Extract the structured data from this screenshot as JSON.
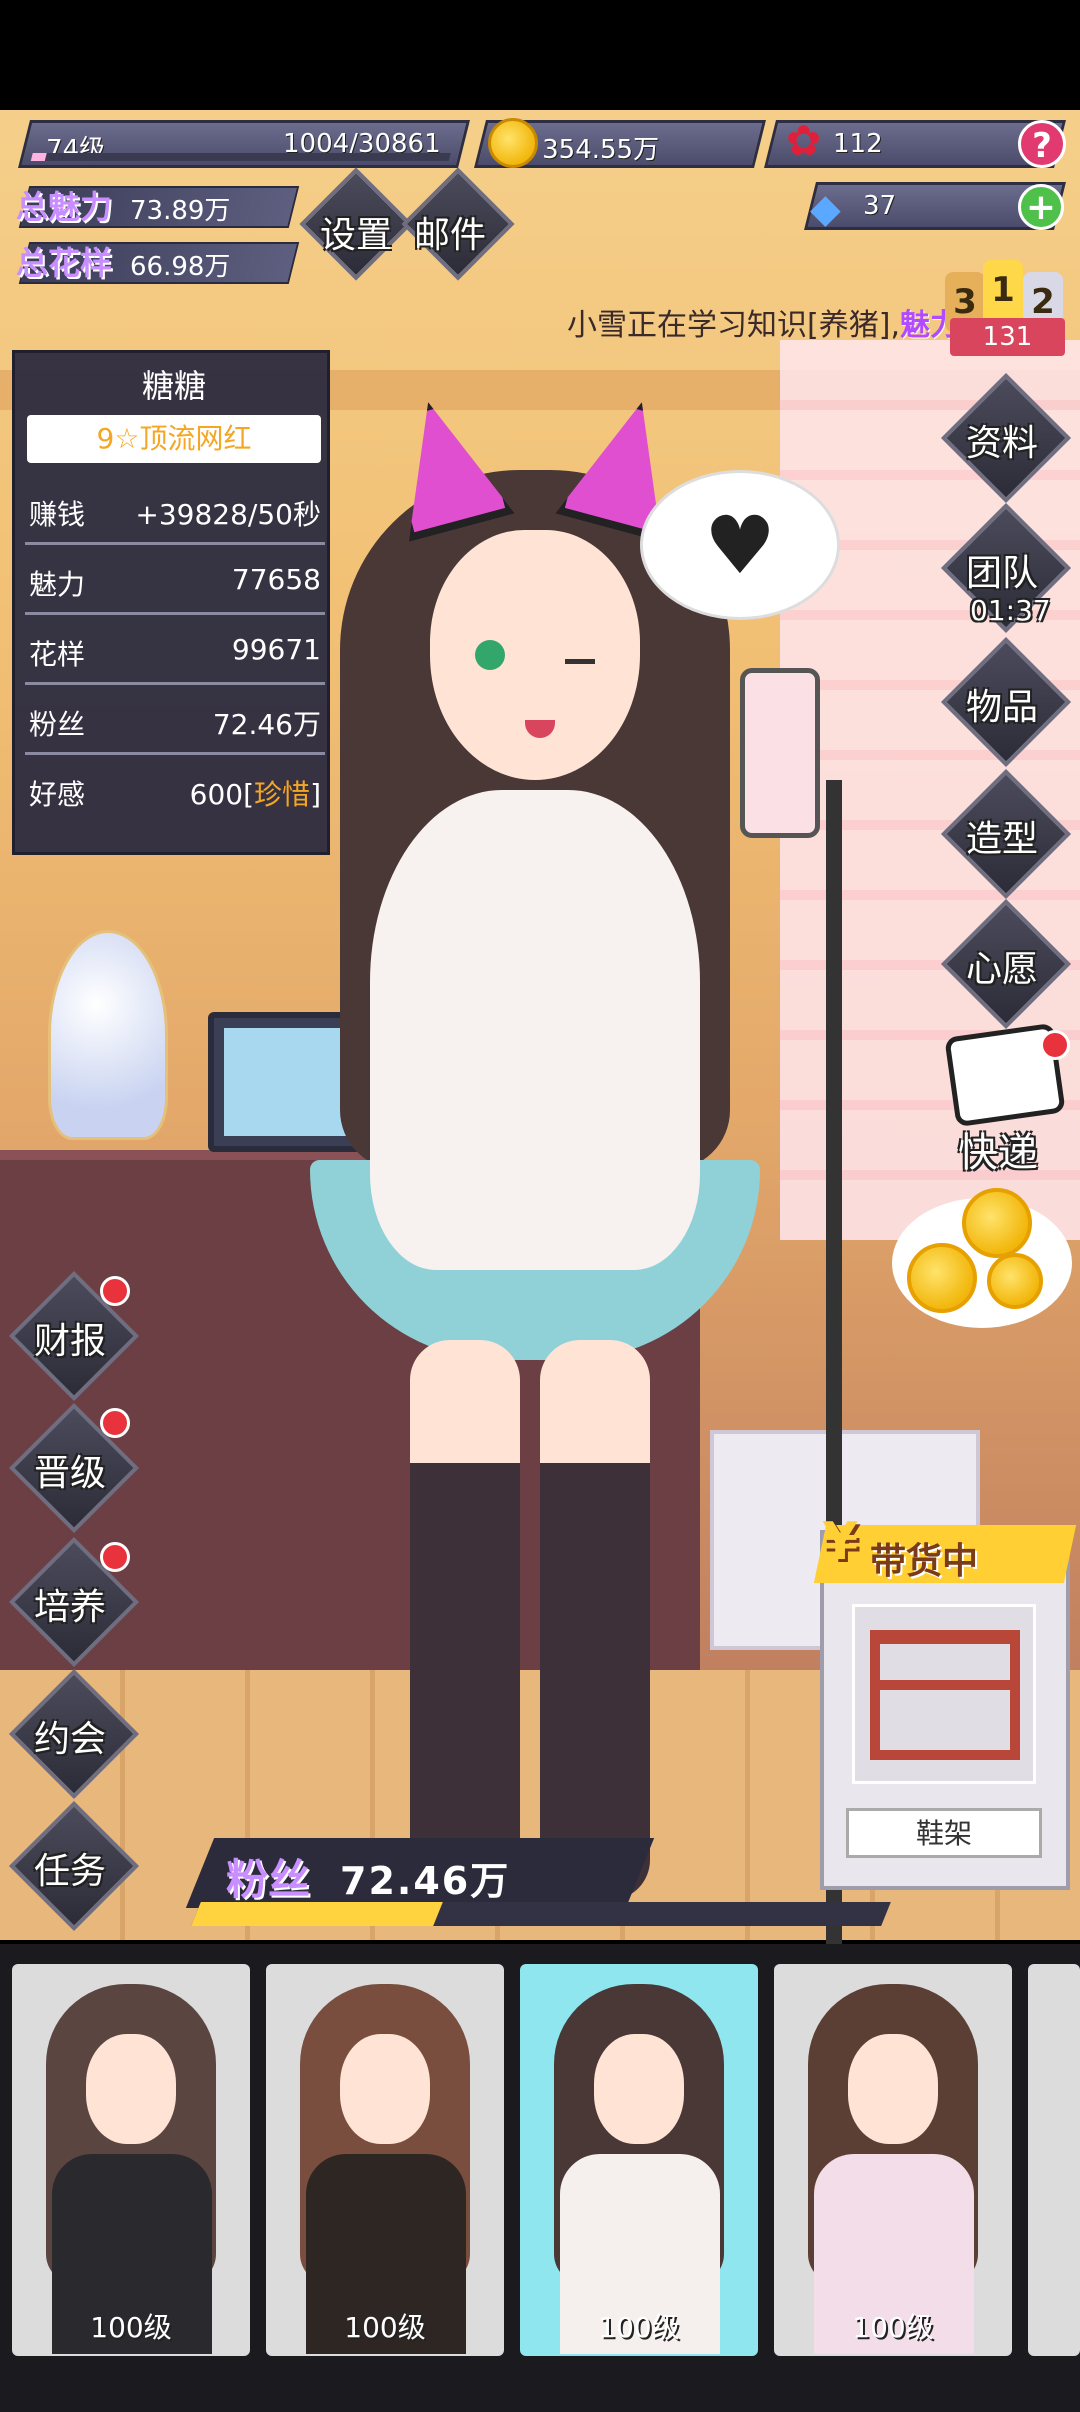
{
  "hud": {
    "level": "74级",
    "exp": "1004/30861",
    "exp_progress": 0.0325,
    "coins": "354.55万",
    "roses": "112",
    "gems": "37",
    "help_icon": "question-icon",
    "plus_icon": "plus-icon"
  },
  "stats": {
    "charm_label": "总魅力",
    "charm_value": "73.89万",
    "style_label": "总花样",
    "style_value": "66.98万"
  },
  "menu_top": {
    "settings": "设置",
    "mail": "邮件"
  },
  "ticker": {
    "text": "小雪正在学习知识[养猪],",
    "highlight": "魅力"
  },
  "rank": {
    "places": [
      "3",
      "1",
      "2"
    ],
    "score": "131"
  },
  "info_panel": {
    "name": "糖糖",
    "title": "9☆顶流网红",
    "rows": [
      {
        "key": "赚钱",
        "value": "+39828/50秒"
      },
      {
        "key": "魅力",
        "value": "77658"
      },
      {
        "key": "花样",
        "value": "99671"
      },
      {
        "key": "粉丝",
        "value": "72.46万"
      },
      {
        "key": "好感",
        "value": "600[",
        "value_hl": "珍惜",
        "value_end": "]"
      }
    ]
  },
  "right_menu": {
    "profile": "资料",
    "team": "团队",
    "team_timer": "01:37",
    "items": "物品",
    "style": "造型",
    "wish": "心愿",
    "express": "快递"
  },
  "left_menu": {
    "earnings": "财报",
    "promote": "晋级",
    "train": "培养",
    "date": "约会",
    "tasks": "任务"
  },
  "selling": {
    "currency_symbol": "¥",
    "header": "带货中",
    "item_name": "鞋架"
  },
  "fans": {
    "label": "粉丝",
    "value": "72.46万",
    "progress": 0.35
  },
  "characters": [
    {
      "level": "100级",
      "hair": "#5a4540",
      "outfit": "#2a2a2e"
    },
    {
      "level": "100级",
      "hair": "#7a4e3e",
      "outfit": "#2e2623"
    },
    {
      "level": "100级",
      "hair": "#4a3836",
      "outfit": "#f5f0ee"
    },
    {
      "level": "100级",
      "hair": "#5c3f34",
      "outfit": "#f3dde8"
    }
  ],
  "colors": {
    "accent_purple": "#c88dff",
    "gold": "#ffcf33",
    "red_dot": "#e8323c"
  }
}
